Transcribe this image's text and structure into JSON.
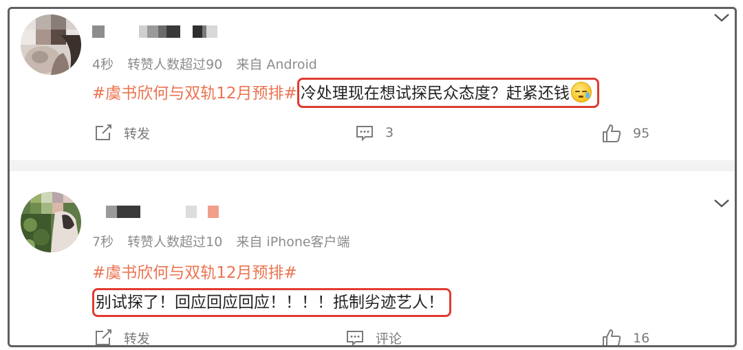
{
  "posts": [
    {
      "time": "4秒",
      "repost_info": "转赞人数超过90",
      "source": "来自 Android",
      "topic": "#虞书欣何与双轨12月预排#",
      "text": "冷处理现在想试探民众态度？赶紧还钱",
      "emoji": "sweat-face-emoji",
      "repost_label": "转发",
      "comment_count": "3",
      "like_count": "95"
    },
    {
      "time": "7秒",
      "repost_info": "转赞人数超过10",
      "source": "来自 iPhone客户端",
      "topic": "#虞书欣何与双轨12月预排#",
      "text": "别试探了！回应回应回应！！！！抵制劣迹艺人！",
      "repost_label": "转发",
      "comment_label": "评论",
      "like_count": "16"
    }
  ],
  "colors": {
    "topic": "#eb7350",
    "highlight_border": "#e03a2f",
    "frame": "#5f5f5f",
    "meta": "#8c8c8c"
  }
}
